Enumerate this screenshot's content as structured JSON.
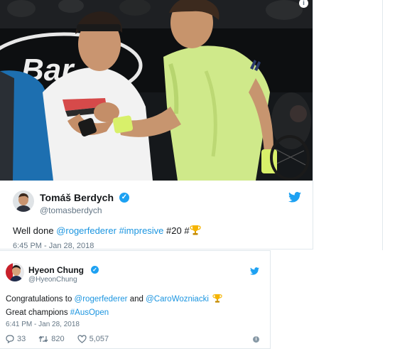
{
  "tweet1": {
    "photo": {
      "board_text": "Bar"
    },
    "author": {
      "name": "Tomáš Berdych",
      "handle": "@tomasberdych"
    },
    "text": {
      "prefix": "Well done ",
      "mention": "@rogerfederer",
      "hashtag": "#impresive",
      "suffix": " #20 #"
    },
    "timestamp": "6:45 PM - Jan 28, 2018"
  },
  "tweet2": {
    "author": {
      "name": "Hyeon Chung",
      "handle": "@HyeonChung"
    },
    "text": {
      "line1_prefix": "Congratulations to ",
      "mention1": "@rogerfederer",
      "and": " and ",
      "mention2": "@CaroWozniacki",
      "line2_prefix": "Great champions ",
      "hashtag": "#AusOpen"
    },
    "timestamp": "6:41 PM - Jan 28, 2018",
    "stats": {
      "replies": "33",
      "retweets": "820",
      "likes": "5,057"
    }
  },
  "colors": {
    "link": "#1b95e0",
    "twitter_blue": "#1da1f2",
    "secondary_text": "#657786"
  }
}
